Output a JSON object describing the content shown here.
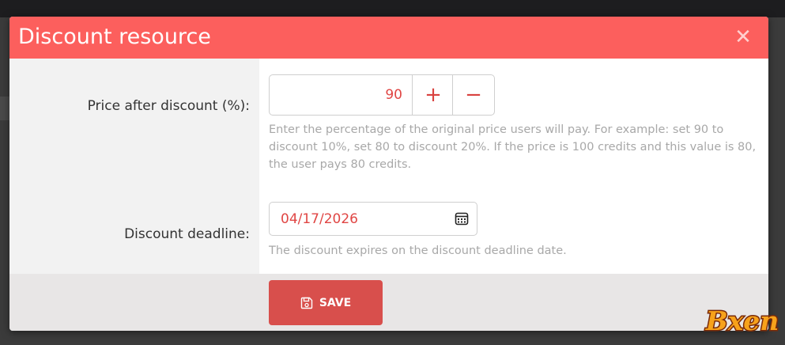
{
  "modal": {
    "title": "Discount resource",
    "close_symbol": "✕"
  },
  "price_field": {
    "label": "Price after discount (%):",
    "value": "90",
    "increment_symbol": "+",
    "decrement_symbol": "−",
    "help": "Enter the percentage of the original price users will pay. For example: set 90 to discount 10%, set 80 to discount 20%. If the price is 100 credits and this value is 80, the user pays 80 credits."
  },
  "deadline_field": {
    "label": "Discount deadline:",
    "value": "04/17/2026",
    "help": "The discount expires on the discount deadline date."
  },
  "footer": {
    "save_label": "SAVE"
  },
  "watermark": {
    "text": "Bxen"
  },
  "icons": {
    "close": "close-icon",
    "calendar": "calendar-icon",
    "save": "floppy-disk-icon"
  },
  "colors": {
    "header": "#fc5f5d",
    "accent_text": "#e04644",
    "save_button": "#d84f4c"
  }
}
